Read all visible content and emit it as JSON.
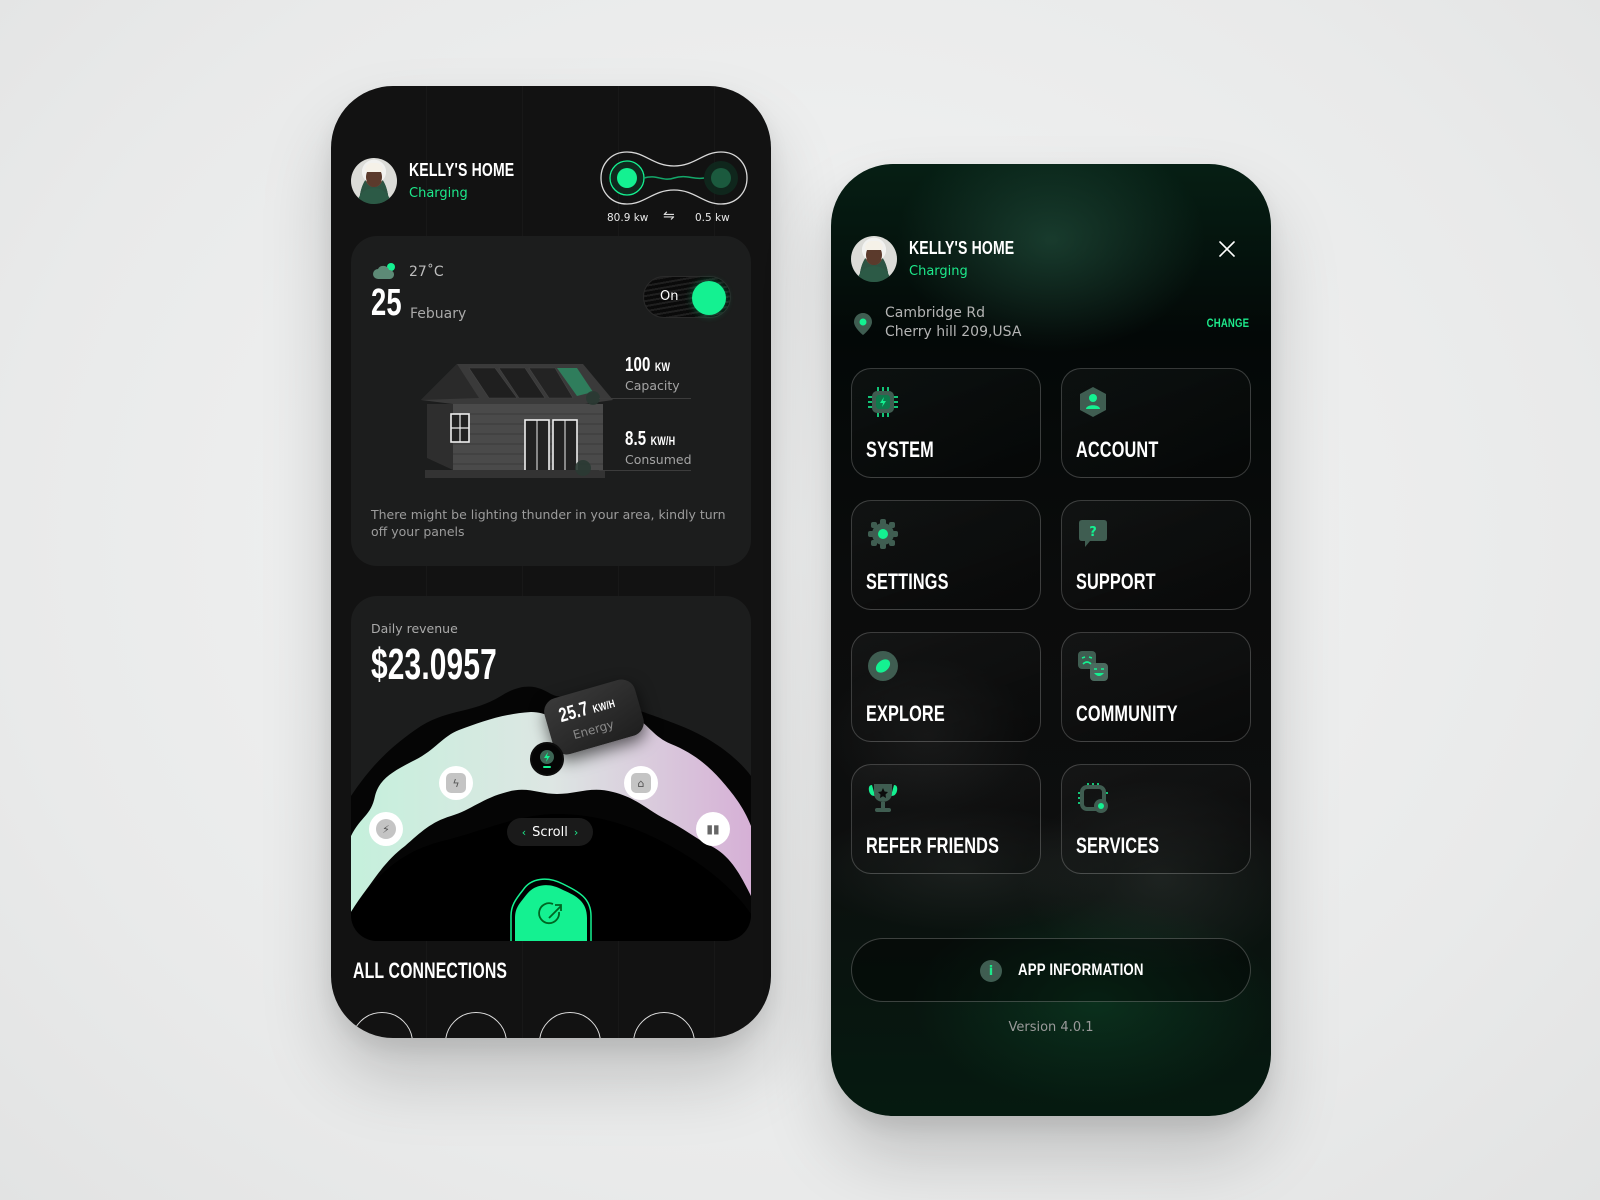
{
  "colors": {
    "accent": "#14F191",
    "accent_text": "#1DE98B",
    "phone_bg": "#121212",
    "card_bg": "#1C1D1D"
  },
  "dashboard": {
    "header": {
      "title": "KELLY'S HOME",
      "status": "Charging",
      "avatar_icon": "user-avatar"
    },
    "energy_flow": {
      "left_value": "80.9 kw",
      "right_value": "0.5 kw",
      "swap_icon": "⇋"
    },
    "weather": {
      "icon": "cloud-icon",
      "temperature": "27˚C",
      "day": "25",
      "month": "Febuary",
      "toggle_label": "On",
      "toggle_on": true
    },
    "stats": [
      {
        "value": "100",
        "unit": "KW",
        "label": "Capacity"
      },
      {
        "value": "8.5",
        "unit": "KW/H",
        "label": "Consumed"
      }
    ],
    "warning": "There might be lighting thunder in your area, kindly turn off your panels",
    "revenue": {
      "label": "Daily revenue",
      "value": "$23.0957"
    },
    "energy_badge": {
      "value": "25.7",
      "unit": "KW/H",
      "label": "Energy"
    },
    "arc_icons": [
      {
        "name": "lightning",
        "glyph": "⚡"
      },
      {
        "name": "battery-charging",
        "glyph": "ϟ"
      },
      {
        "name": "bulb",
        "glyph": "⚡"
      },
      {
        "name": "home-trend",
        "glyph": "⌂"
      },
      {
        "name": "panel",
        "glyph": "▮▮"
      }
    ],
    "scroll": {
      "left_chevron": "‹",
      "label": "Scroll",
      "right_chevron": "›"
    },
    "all_connections_title": "ALL CONNECTIONS"
  },
  "menu": {
    "header": {
      "title": "KELLY'S HOME",
      "status": "Charging"
    },
    "location": {
      "line1": "Cambridge Rd",
      "line2": "Cherry hill 209,USA",
      "change_label": "CHANGE"
    },
    "tiles": [
      {
        "label": "SYSTEM",
        "icon": "chip-icon"
      },
      {
        "label": "ACCOUNT",
        "icon": "user-hexagon-icon"
      },
      {
        "label": "SETTINGS",
        "icon": "gear-icon"
      },
      {
        "label": "SUPPORT",
        "icon": "question-chat-icon"
      },
      {
        "label": "EXPLORE",
        "icon": "explore-icon"
      },
      {
        "label": "COMMUNITY",
        "icon": "faces-icon"
      },
      {
        "label": "REFER FRIENDS",
        "icon": "trophy-icon"
      },
      {
        "label": "SERVICES",
        "icon": "chip-gear-icon"
      }
    ],
    "app_info": {
      "icon": "i",
      "label": "APP INFORMATION"
    },
    "version": "Version 4.0.1"
  }
}
